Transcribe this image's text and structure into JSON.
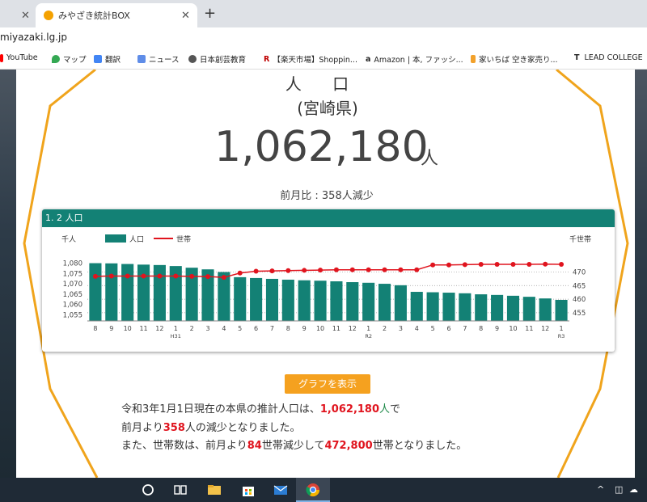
{
  "browser": {
    "tab_inactive_close": "✕",
    "tab_active_title": "みやざき統計BOX",
    "tab_active_close": "✕",
    "new_tab": "+",
    "url": "miyazaki.lg.jp",
    "bookmarks": [
      "YouTube",
      "マップ",
      "翻訳",
      "ニュース",
      "日本創芸教育",
      "【楽天市場】Shoppin...",
      "Amazon | 本, ファッシ...",
      "家いちば 空き家売り...",
      "LEAD COLLEGE"
    ]
  },
  "modal": {
    "title": "人 口",
    "prefecture": "(宮崎県)",
    "population": "1,062,180",
    "unit": "人",
    "month_over_month": "前月比 : 358人減少",
    "panel_title": "1. 2 人口",
    "show_graph_button": "グラフを表示",
    "desc_line1_a": "令和3年1月1日現在の本県の推計人口は、",
    "desc_line1_num": "1,062,180",
    "desc_line1_unit": "人",
    "desc_line1_b": "で",
    "desc_line2_a": "前月より",
    "desc_line2_num": "358",
    "desc_line2_b": "人の減少となりました。",
    "desc_line3_a": "また、世帯数は、前月より",
    "desc_line3_num": "84",
    "desc_line3_b": "世帯減少して",
    "desc_line3_num2": "472,800",
    "desc_line3_c": "世帯となりました。"
  },
  "colors": {
    "accent": "#138175",
    "hex": "#f0a41c",
    "line": "#e0141e"
  },
  "chart_data": {
    "type": "bar",
    "left_unit": "千人",
    "right_unit": "千世帯",
    "legend": [
      {
        "name": "人口",
        "color": "#138175"
      },
      {
        "name": "世帯",
        "color": "#e0141e"
      }
    ],
    "categories": [
      "8",
      "9",
      "10",
      "11",
      "12",
      "1",
      "2",
      "3",
      "4",
      "5",
      "6",
      "7",
      "8",
      "9",
      "10",
      "11",
      "12",
      "1",
      "2",
      "3",
      "4",
      "5",
      "6",
      "7",
      "8",
      "9",
      "10",
      "11",
      "12",
      "1"
    ],
    "era_labels": [
      {
        "label": "H31",
        "index": 5
      },
      {
        "label": "R2",
        "index": 17
      },
      {
        "label": "R3",
        "index": 29
      }
    ],
    "yticks_left": [
      "1,080",
      "1,075",
      "1,070",
      "1,065",
      "1,060",
      "1,055"
    ],
    "yticks_right": [
      "470",
      "465",
      "460",
      "455"
    ],
    "ylim_left": [
      1052,
      1081
    ],
    "ylim_right": [
      452,
      474
    ],
    "series": [
      {
        "name": "人口",
        "values": [
          1080.0,
          1079.9,
          1079.6,
          1079.3,
          1079.1,
          1078.6,
          1077.8,
          1077.0,
          1075.7,
          1073.2,
          1072.8,
          1072.4,
          1072.0,
          1071.7,
          1071.5,
          1071.2,
          1070.8,
          1070.5,
          1070.0,
          1069.3,
          1066.1,
          1065.9,
          1065.7,
          1065.4,
          1064.9,
          1064.6,
          1064.2,
          1063.7,
          1062.9,
          1062.2
        ]
      },
      {
        "name": "世帯",
        "values": [
          468.4,
          468.5,
          468.5,
          468.5,
          468.5,
          468.5,
          468.4,
          468.3,
          468.0,
          469.6,
          470.3,
          470.4,
          470.5,
          470.6,
          470.7,
          470.8,
          470.8,
          470.8,
          470.8,
          470.8,
          470.8,
          472.6,
          472.6,
          472.7,
          472.8,
          472.8,
          472.8,
          472.8,
          472.9,
          472.8
        ]
      }
    ]
  }
}
